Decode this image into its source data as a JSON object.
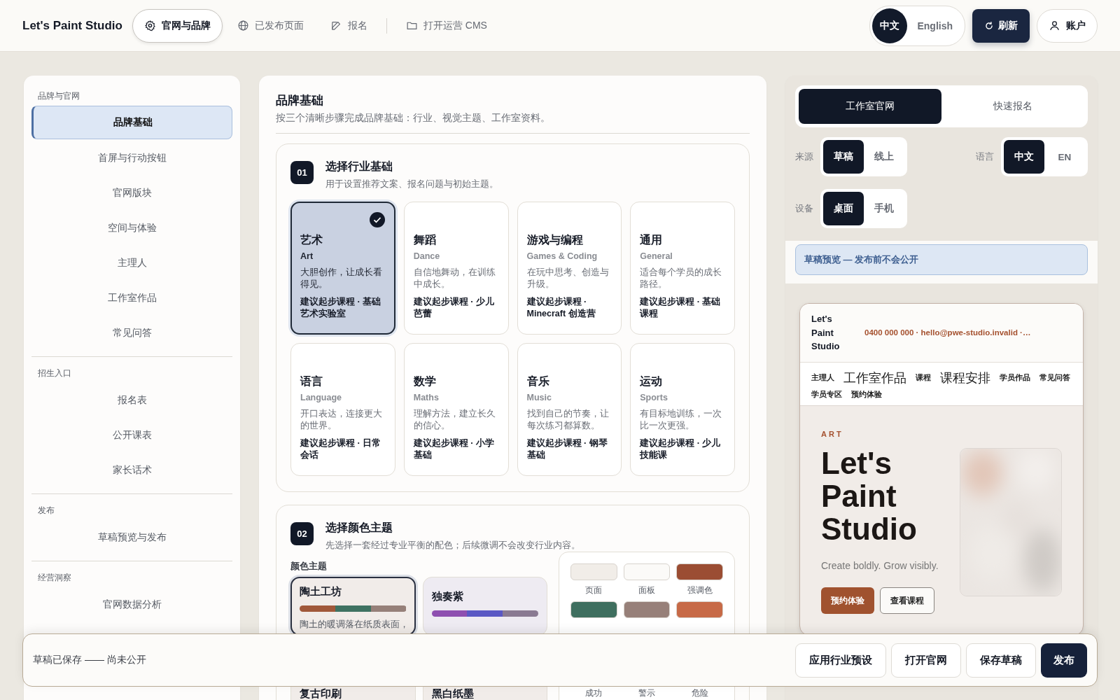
{
  "header": {
    "brand": "Let's Paint Studio",
    "nav": [
      {
        "label": "官网与品牌",
        "kind": "page",
        "selected": true
      },
      {
        "label": "已发布页面",
        "kind": "page",
        "selected": false
      },
      {
        "label": "报名",
        "kind": "page",
        "selected": false
      },
      {
        "label": "打开运营 CMS",
        "kind": "external",
        "selected": false
      }
    ],
    "languages": [
      {
        "label": "中文",
        "selected": true
      },
      {
        "label": "English",
        "selected": false
      }
    ],
    "refresh": "刷新",
    "account": "账户"
  },
  "sidebar": {
    "sections": [
      {
        "title": "品牌与官网",
        "items": [
          {
            "label": "品牌基础",
            "selected": true
          },
          {
            "label": "首屏与行动按钮",
            "selected": false
          },
          {
            "label": "官网版块",
            "selected": false
          },
          {
            "label": "空间与体验",
            "selected": false
          },
          {
            "label": "主理人",
            "selected": false
          },
          {
            "label": "工作室作品",
            "selected": false
          },
          {
            "label": "常见问答",
            "selected": false
          }
        ]
      },
      {
        "title": "招生入口",
        "items": [
          {
            "label": "报名表",
            "selected": false
          },
          {
            "label": "公开课表",
            "selected": false
          },
          {
            "label": "家长话术",
            "selected": false
          }
        ]
      },
      {
        "title": "发布",
        "items": [
          {
            "label": "草稿预览与发布",
            "selected": false
          }
        ]
      },
      {
        "title": "经营洞察",
        "items": [
          {
            "label": "官网数据分析",
            "selected": false
          }
        ]
      }
    ]
  },
  "main": {
    "title": "品牌基础",
    "subtitle": "按三个清晰步骤完成品牌基础：行业、视觉主题、工作室资料。"
  },
  "industry_step": {
    "number": "01",
    "title": "选择行业基础",
    "subtitle": "用于设置推荐文案、报名问题与初始主题。",
    "industries": [
      {
        "name": "艺术",
        "english": "Art",
        "description": "大胆创作，让成长看得见。",
        "course": "建议起步课程 · 基础艺术实验室",
        "selected": true
      },
      {
        "name": "舞蹈",
        "english": "Dance",
        "description": "自信地舞动，在训练中成长。",
        "course": "建议起步课程 · 少儿芭蕾",
        "selected": false
      },
      {
        "name": "游戏与编程",
        "english": "Games & Coding",
        "description": "在玩中思考、创造与升级。",
        "course": "建议起步课程 · Minecraft 创造营",
        "selected": false
      },
      {
        "name": "通用",
        "english": "General",
        "description": "适合每个学员的成长路径。",
        "course": "建议起步课程 · 基础课程",
        "selected": false
      },
      {
        "name": "语言",
        "english": "Language",
        "description": "开口表达，连接更大的世界。",
        "course": "建议起步课程 · 日常会话",
        "selected": false
      },
      {
        "name": "数学",
        "english": "Maths",
        "description": "理解方法，建立长久的信心。",
        "course": "建议起步课程 · 小学基础",
        "selected": false
      },
      {
        "name": "音乐",
        "english": "Music",
        "description": "找到自己的节奏，让每次练习都算数。",
        "course": "建议起步课程 · 钢琴基础",
        "selected": false
      },
      {
        "name": "运动",
        "english": "Sports",
        "description": "有目标地训练，一次比一次更强。",
        "course": "建议起步课程 · 少儿技能课",
        "selected": false
      }
    ]
  },
  "theme_step": {
    "number": "02",
    "title": "选择颜色主题",
    "subtitle": "先选择一套经过专业平衡的配色；后续微调不会改变行业内容。",
    "themes_label": "颜色主题",
    "themes": [
      {
        "name": "陶土工坊",
        "palette": [
          {
            "color": "#a0583a"
          },
          {
            "color": "#3f7262"
          },
          {
            "color": "#968079"
          }
        ],
        "description": "陶土的暖调落在纸质表面，",
        "selected": true
      },
      {
        "name": "独奏紫",
        "palette": [
          {
            "color": "#8e4fb0"
          },
          {
            "color": "#5a58c4"
          },
          {
            "color": "#8a7a92"
          }
        ],
        "selected": false
      },
      {
        "name": "复古印刷",
        "selected": false
      },
      {
        "name": "黑白纸墨",
        "selected": false
      }
    ],
    "swatches": [
      {
        "label": "页面",
        "color": "#f1ede8"
      },
      {
        "label": "面板",
        "color": "#fbfaf8"
      },
      {
        "label": "强调色",
        "color": "#9b4d33"
      },
      {
        "color": "#3f6f5f"
      },
      {
        "color": "#978079"
      },
      {
        "color": "#c76a47"
      },
      {
        "label": "成功"
      },
      {
        "label": "警示"
      },
      {
        "label": "危险"
      }
    ]
  },
  "preview": {
    "modes": [
      {
        "label": "工作室官网",
        "selected": true
      },
      {
        "label": "快速报名",
        "selected": false
      }
    ],
    "source": {
      "label": "来源",
      "options": [
        {
          "label": "草稿",
          "selected": true
        },
        {
          "label": "线上",
          "selected": false
        }
      ]
    },
    "language": {
      "label": "语言",
      "options": [
        {
          "label": "中文",
          "selected": true
        },
        {
          "label": "EN",
          "selected": false
        }
      ]
    },
    "device": {
      "label": "设备",
      "options": [
        {
          "label": "桌面",
          "selected": true
        },
        {
          "label": "手机",
          "selected": false
        }
      ]
    },
    "notice": "草稿预览 — 发布前不会公开",
    "site": {
      "brand": "Let's Paint Studio",
      "contact": "0400 000 000 · hello@pwe-studio.invalid ·…",
      "nav": [
        {
          "label": "主理人",
          "kind": "small"
        },
        {
          "label": "工作室作品",
          "kind": "large"
        },
        {
          "label": "课程",
          "kind": "small"
        },
        {
          "label": "课程安排",
          "kind": "large"
        },
        {
          "label": "学员作品",
          "kind": "small"
        },
        {
          "label": "常见问答",
          "kind": "small"
        },
        {
          "label": "学员专区",
          "kind": "small"
        },
        {
          "label": "预约体验",
          "kind": "small"
        }
      ],
      "eyebrow": "ART",
      "headline": "Let's Paint Studio",
      "tagline": "Create boldly. Grow visibly.",
      "buttons": [
        {
          "label": "预约体验",
          "kind": "primary"
        },
        {
          "label": "查看课程",
          "kind": "secondary"
        }
      ]
    }
  },
  "footer": {
    "status": "草稿已保存 —— 尚未公开",
    "actions": [
      {
        "label": "应用行业预设",
        "kind": "secondary"
      },
      {
        "label": "打开官网",
        "kind": "secondary"
      },
      {
        "label": "保存草稿",
        "kind": "secondary"
      },
      {
        "label": "发布",
        "kind": "primary"
      }
    ]
  }
}
